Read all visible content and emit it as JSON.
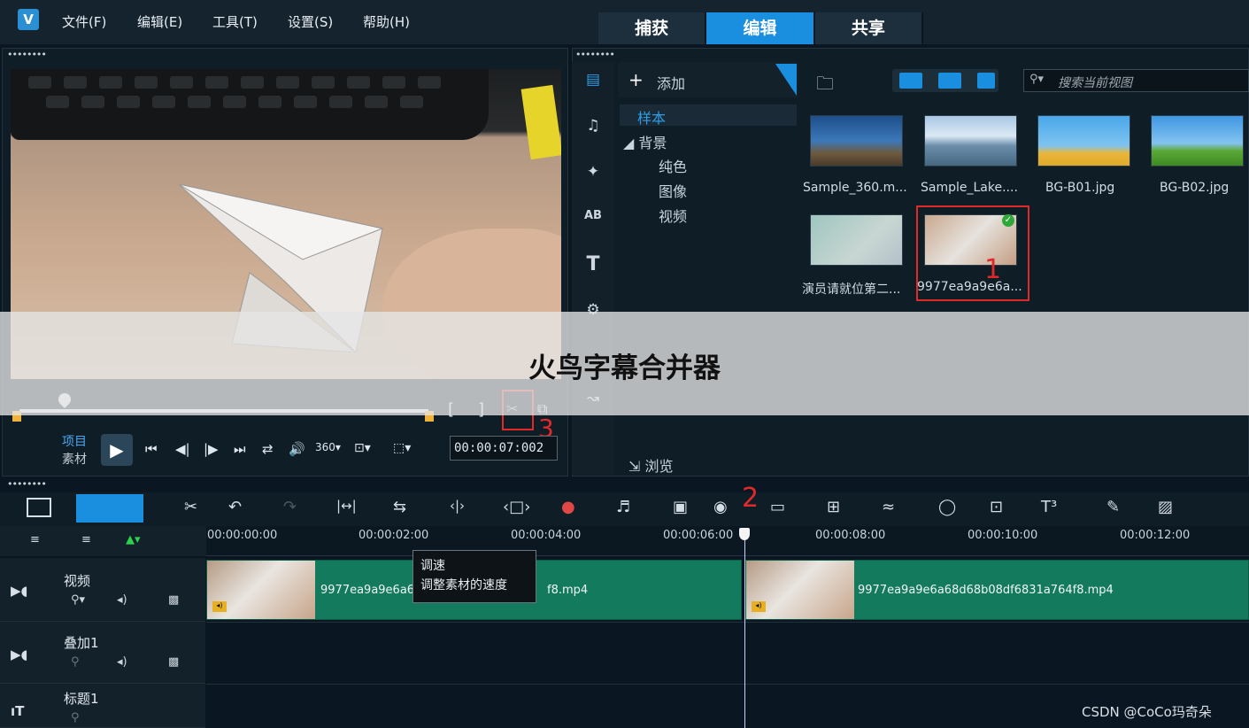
{
  "menubar": {
    "items": [
      "文件(F)",
      "编辑(E)",
      "工具(T)",
      "设置(S)",
      "帮助(H)"
    ],
    "tabs": [
      "捕获",
      "编辑",
      "共享"
    ]
  },
  "preview": {
    "mode_project": "项目",
    "mode_clip": "素材",
    "timecode": "00:00:07:002",
    "mark_in": "[",
    "mark_out": "]"
  },
  "library": {
    "add_label": "添加",
    "tree": {
      "sample": "样本",
      "background": "背景",
      "solid": "纯色",
      "image": "图像",
      "video": "视频"
    },
    "browse_label": "浏览",
    "search_placeholder": "搜索当前视图",
    "thumbs": [
      {
        "label": "Sample_360.m..."
      },
      {
        "label": "Sample_Lake...."
      },
      {
        "label": "BG-B01.jpg"
      },
      {
        "label": "BG-B02.jpg"
      },
      {
        "label": "演员请就位第二..."
      },
      {
        "label": "9977ea9a9e6a..."
      }
    ]
  },
  "annotations": {
    "n1": "1",
    "n2": "2",
    "n3": "3"
  },
  "overlay": {
    "title": "火鸟字幕合并器"
  },
  "timeline": {
    "ruler": [
      "00:00:00:00",
      "00:00:02:00",
      "00:00:04:00",
      "00:00:06:00",
      "00:00:08:00",
      "00:00:10:00",
      "00:00:12:00"
    ],
    "tracks": [
      "视频",
      "叠加1",
      "标题1"
    ],
    "clip1_name": "9977ea9a9e6a6",
    "clip1_suffix": "f8.mp4",
    "clip2_name": "9977ea9a9e6a68d68b08df6831a764f8.mp4",
    "tooltip_title": "调速",
    "tooltip_desc": "调整素材的速度"
  },
  "watermark": "CSDN @CoCo玛奇朵",
  "colors": {
    "accent": "#1a8fe0",
    "clip": "#147a5e",
    "annotation": "#e02a2a"
  }
}
